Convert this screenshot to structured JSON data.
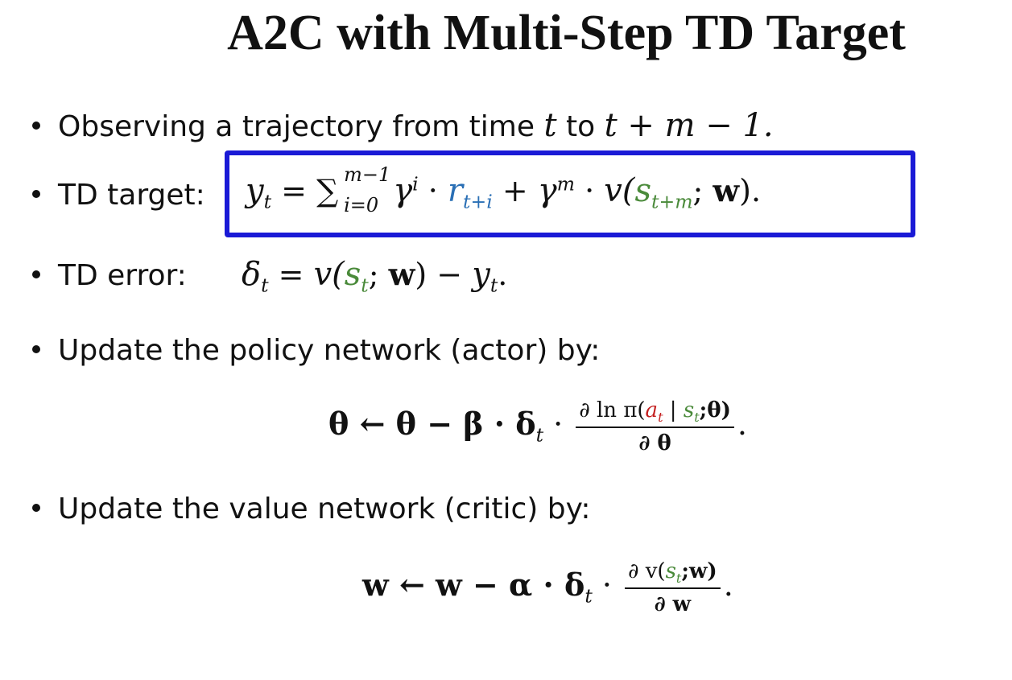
{
  "title": "A2C with Multi-Step TD Target",
  "bullets": {
    "observe_text": "Observing a trajectory from time",
    "observe_t": "t",
    "observe_to": "to",
    "observe_range": "t + m − 1.",
    "td_target_label": "TD target:",
    "td_error_label": "TD error:",
    "update_actor": "Update the policy network (actor) by:",
    "update_critic": "Update the value network (critic) by:"
  },
  "td_target": {
    "lhs": "y",
    "lhs_sub": "t",
    "eq": " = ",
    "sum": "∑",
    "sum_upper": "m−1",
    "sum_lower": "i=0",
    "gamma_i": "γ",
    "gamma_i_sup": "i",
    "dot1": " · ",
    "r": "r",
    "r_sub": "t+i",
    "plus": " + ",
    "gamma_m": "γ",
    "gamma_m_sup": "m",
    "dot2": " · ",
    "v": "v(",
    "s": "s",
    "s_sub": "t+m",
    "semi": "; ",
    "w": "w",
    "close": ")."
  },
  "td_error": {
    "delta": "δ",
    "delta_sub": "t",
    "eq": " = ",
    "v": "v(",
    "s": "s",
    "s_sub": "t",
    "semi": "; ",
    "w": "w",
    "mid": ") − ",
    "y": "y",
    "y_sub": "t",
    "end": "."
  },
  "actor_update": {
    "lhs": "θ ← θ − β · δ",
    "delta_sub": "t",
    "dot": " · ",
    "num_prefix": "∂ ln π(",
    "a": "a",
    "a_sub": "t",
    "bar": " | ",
    "s": "s",
    "s_sub": "t",
    "num_suffix": ";θ)",
    "den": "∂ θ",
    "end": "."
  },
  "critic_update": {
    "lhs": "w ← w − α · δ",
    "delta_sub": "t",
    "dot": " · ",
    "num_prefix": "∂ v(",
    "s": "s",
    "s_sub": "t",
    "num_suffix": ";w)",
    "den": "∂ w",
    "end": "."
  },
  "colors": {
    "box_border": "#1a1ad6",
    "reward": "#2a6fb5",
    "state": "#4a8a3a",
    "action": "#c42020"
  }
}
